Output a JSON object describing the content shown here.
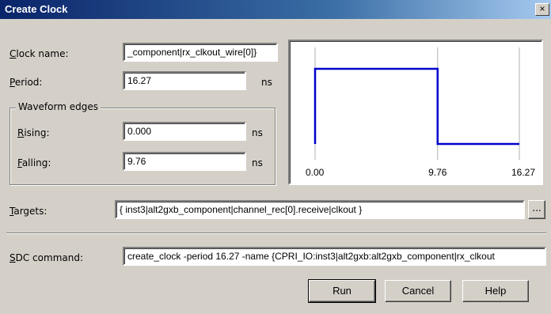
{
  "window": {
    "title": "Create Clock",
    "close_glyph": "×"
  },
  "clock_name": {
    "label_u": "C",
    "label_rest": "lock name:",
    "value": "_component|rx_clkout_wire[0]}"
  },
  "period": {
    "label_u": "P",
    "label_rest": "eriod:",
    "value": "16.27",
    "unit": "ns"
  },
  "waveform_edges": {
    "title": "Waveform edges",
    "rising": {
      "label_u": "R",
      "label_rest": "ising:",
      "value": "0.000",
      "unit": "ns"
    },
    "falling": {
      "label_u": "F",
      "label_rest": "alling:",
      "value": "9.76",
      "unit": "ns"
    }
  },
  "waveform": {
    "ticks": [
      "0.00",
      "9.76",
      "16.27"
    ],
    "period": 16.27,
    "rising": 0.0,
    "falling": 9.76,
    "color": "#0000cc"
  },
  "targets": {
    "label_u": "T",
    "label_rest": "argets:",
    "value": "{ inst3|alt2gxb_component|channel_rec[0].receive|clkout }",
    "browse_label": "..."
  },
  "sdc": {
    "label_u": "S",
    "label_rest": "DC command:",
    "value": "create_clock -period 16.27 -name {CPRI_IO:inst3|alt2gxb:alt2gxb_component|rx_clkout"
  },
  "buttons": {
    "run": "Run",
    "cancel": "Cancel",
    "help": "Help"
  }
}
